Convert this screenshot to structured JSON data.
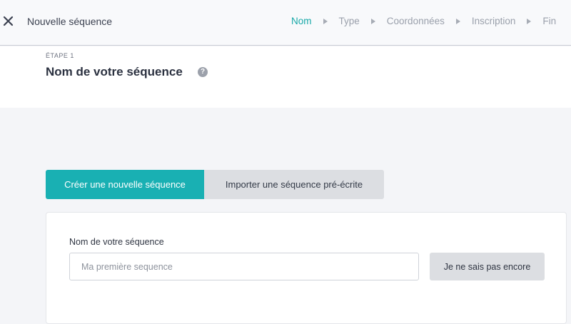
{
  "topbar": {
    "close_icon": "close-icon",
    "title": "Nouvelle séquence",
    "steps": [
      {
        "label": "Nom",
        "active": true
      },
      {
        "label": "Type",
        "active": false
      },
      {
        "label": "Coordonnées",
        "active": false
      },
      {
        "label": "Inscription",
        "active": false
      },
      {
        "label": "Fin",
        "active": false
      }
    ]
  },
  "header": {
    "step_label": "ÉTAPE 1",
    "title": "Nom de votre séquence",
    "help_icon": "question-circle-icon"
  },
  "tabs": [
    {
      "label": "Créer une nouvelle séquence",
      "active": true
    },
    {
      "label": "Importer une séquence pré-écrite",
      "active": false
    }
  ],
  "form": {
    "field_label": "Nom de votre séquence",
    "input_value": "",
    "input_placeholder": "Ma première sequence",
    "secondary_button": "Je ne sais pas encore"
  },
  "colors": {
    "accent": "#19b0b3",
    "step_active": "#17a8a8"
  }
}
